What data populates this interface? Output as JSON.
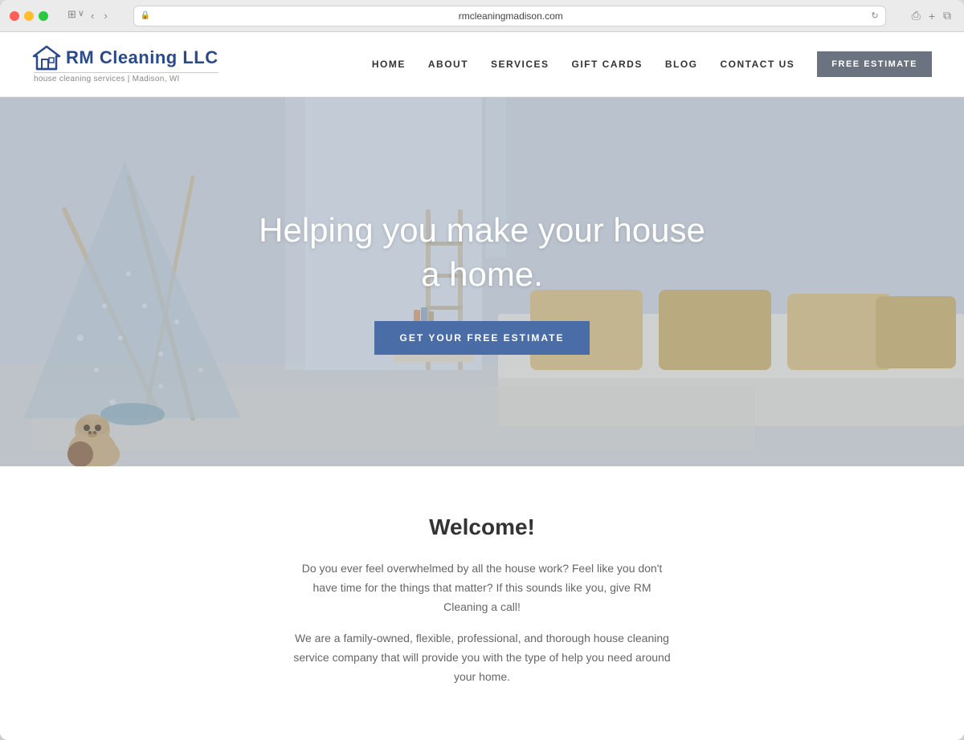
{
  "browser": {
    "url": "rmcleaningmadison.com",
    "traffic_lights": [
      "red",
      "yellow",
      "green"
    ]
  },
  "header": {
    "logo_text": "RM Cleaning LLC",
    "logo_tagline": "house cleaning services | Madison, WI",
    "nav_items": [
      {
        "label": "HOME",
        "id": "home"
      },
      {
        "label": "ABOUT",
        "id": "about"
      },
      {
        "label": "SERVICES",
        "id": "services"
      },
      {
        "label": "GIFT CARDS",
        "id": "gift-cards"
      },
      {
        "label": "BLOG",
        "id": "blog"
      },
      {
        "label": "CONTACT US",
        "id": "contact"
      }
    ],
    "cta_button": "FREE ESTIMATE"
  },
  "hero": {
    "headline_line1": "Helping you make your house",
    "headline_line2": "a home.",
    "cta_button": "GET YOUR FREE ESTIMATE"
  },
  "welcome": {
    "title": "Welcome!",
    "paragraph1": "Do you ever feel overwhelmed by all the house work? Feel like you don't have time for the things that matter? If this sounds like you, give RM Cleaning a call!",
    "paragraph2": "We are a family-owned, flexible, professional, and thorough house cleaning service company that will provide you with the type of help you need around your home."
  }
}
